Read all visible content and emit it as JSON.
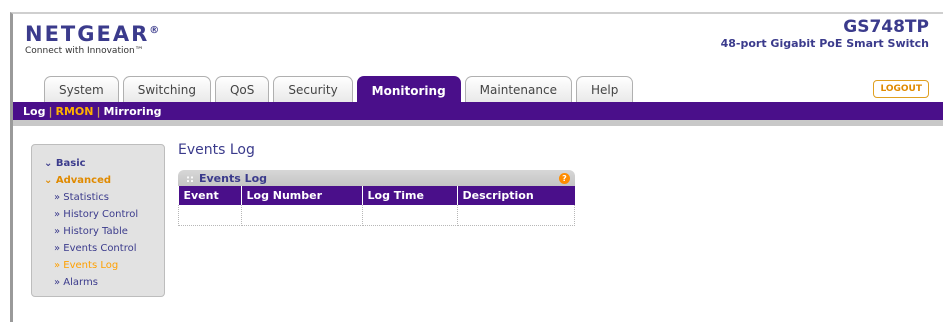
{
  "header": {
    "brand": "NETGEAR",
    "brand_mark": "®",
    "tagline": "Connect with Innovation™",
    "model": "GS748TP",
    "model_desc": "48-port Gigabit PoE Smart Switch"
  },
  "tabs": [
    "System",
    "Switching",
    "QoS",
    "Security",
    "Monitoring",
    "Maintenance",
    "Help"
  ],
  "active_tab": "Monitoring",
  "logout_label": "LOGOUT",
  "subnav": [
    "Log",
    "RMON",
    "Mirroring"
  ],
  "subnav_active": "RMON",
  "sidebar": {
    "sections": [
      {
        "label": "Basic",
        "items": []
      },
      {
        "label": "Advanced",
        "items": [
          "» Statistics",
          "» History Control",
          "» History Table",
          "» Events Control",
          "» Events Log",
          "» Alarms"
        ]
      }
    ],
    "selected_item": "» Events Log"
  },
  "page_title": "Events Log",
  "panel": {
    "title": "Events Log",
    "columns": [
      "Event",
      "Log Number",
      "Log Time",
      "Description"
    ],
    "rows": [
      [
        "",
        "",
        "",
        ""
      ]
    ]
  },
  "colors": {
    "brand_purple": "#4a0f8a",
    "accent_orange": "#ffa000",
    "text_blue": "#3b3b8c"
  },
  "icons": {
    "help": "help-icon",
    "chevron": "chevron-down-icon"
  }
}
